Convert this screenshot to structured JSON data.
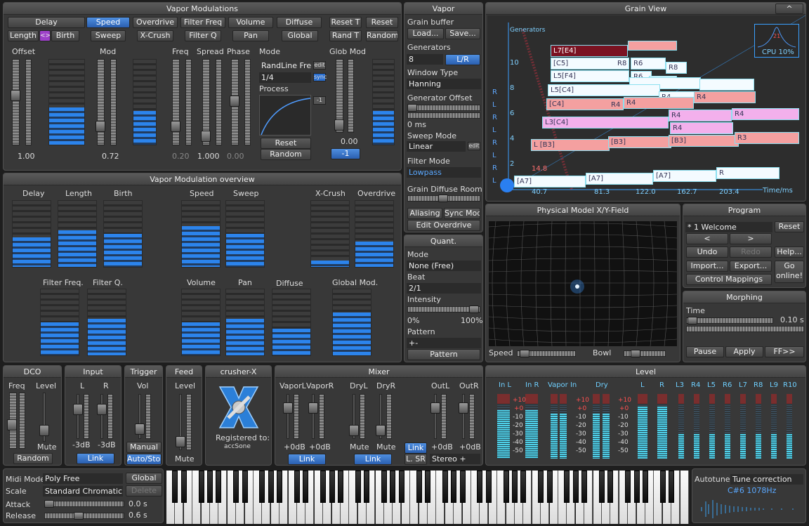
{
  "vapor_modulations": {
    "title": "Vapor Modulations",
    "buttons": [
      "Delay",
      "Speed",
      "Overdrive",
      "Filter Freq",
      "Volume",
      "Diffuse",
      "Reset T",
      "Reset",
      "Length",
      "<>",
      "Birth",
      "Sweep",
      "X-Crush",
      "Filter Q",
      "Pan",
      "Global",
      "Rand T",
      "Random"
    ],
    "labels": [
      "Offset",
      "Mod",
      "Freq",
      "Spread",
      "Phase",
      "Mode",
      "Glob Mod",
      "Process"
    ],
    "values": {
      "offset": "1.00",
      "mod": "0.72",
      "freq": "0.20",
      "spread": "1.000",
      "phase": "0.00",
      "glob": "0.00",
      "mode_badge": "-1"
    },
    "mode": "RandLine Free",
    "rate": "1/4",
    "sync": "sync",
    "edit": "edit",
    "process_badge": "-1",
    "reset": "Reset",
    "random": "Random"
  },
  "overview": {
    "title": "Vapor Modulation overview",
    "labels": [
      "Delay",
      "Length",
      "Birth",
      "Speed",
      "Sweep",
      "X-Crush",
      "Overdrive",
      "Filter Freq.",
      "Filter Q.",
      "Volume",
      "Pan",
      "Diffuse",
      "Global Mod."
    ],
    "levels": [
      0.45,
      0.55,
      0.5,
      0.62,
      0.5,
      0.1,
      0.38,
      0.5,
      0.55,
      0.5,
      0.55,
      0.4,
      0.65
    ]
  },
  "vapor": {
    "title": "Vapor",
    "grain_buffer": "Grain buffer",
    "load": "Load...",
    "save": "Save...",
    "generators_label": "Generators",
    "generators": "8",
    "lr": "L/R",
    "window_type_label": "Window Type",
    "window_type": "Hanning",
    "gen_offset_label": "Generator Offset",
    "gen_offset": "0 ms",
    "sweep_mode_label": "Sweep Mode",
    "sweep_mode": "Linear",
    "edit": "edit",
    "filter_mode_label": "Filter Mode",
    "filter_mode": "Lowpass",
    "diffuse_label": "Grain Diffuse Room",
    "aliasing": "Aliasing",
    "sync_mod": "Sync Mod",
    "edit_overdrive": "Edit Overdrive"
  },
  "grain_view": {
    "title": "Grain View",
    "collapse": "^",
    "y_label": "Generators",
    "x_label": "Time/ms",
    "y_ticks": [
      "10",
      "8",
      "6",
      "4",
      "2"
    ],
    "x_ticks": [
      "40.7",
      "81.3",
      "122.0",
      "162.7",
      "203.4"
    ],
    "lr": [
      "R",
      "L",
      "R",
      "L",
      "R",
      "L",
      "R",
      "L"
    ],
    "marker": "14.8",
    "cpu": "CPU 10%",
    "cpu_value": "21",
    "bar_labels": [
      "L7[E4]",
      "[C5]",
      "R8",
      "R6",
      "R8",
      "R6",
      "R8",
      "L5[F4]",
      "L5[C4]",
      "R4",
      "[C4]",
      "R4",
      "R4",
      "R4",
      "R4",
      "L3[C4]",
      "R4",
      "R4",
      "R3",
      "L [B3]",
      "[B3]",
      "R3",
      "[B3]",
      "R1",
      "[A7]",
      "R",
      "[A7]",
      "R",
      "[A7]",
      "R",
      "R",
      "R"
    ]
  },
  "xy_field": {
    "title": "Physical Model X/Y-Field",
    "speed": "Speed",
    "bowl": "Bowl"
  },
  "quant": {
    "title": "Quant.",
    "mode_label": "Mode",
    "mode": "None (Free)",
    "beat_label": "Beat",
    "beat": "2/1",
    "intensity_label": "Intensity",
    "min": "0%",
    "max": "100%",
    "pattern_label": "Pattern",
    "pattern_value": "+-",
    "pattern_button": "Pattern"
  },
  "program": {
    "title": "Program",
    "name": "* 1 Welcome",
    "reset": "Reset",
    "prev": "<",
    "next": ">",
    "undo": "Undo",
    "redo": "Redo",
    "help": "Help...",
    "import": "Import...",
    "export": "Export...",
    "go_online": "Go online!",
    "control_mappings": "Control Mappings"
  },
  "morphing": {
    "title": "Morphing",
    "time_label": "Time",
    "time": "0.10 s",
    "pause": "Pause",
    "apply": "Apply",
    "ff": "FF>>"
  },
  "dco": {
    "title": "DCO",
    "freq": "Freq",
    "level": "Level",
    "mute": "Mute",
    "random": "Random"
  },
  "input": {
    "title": "Input",
    "l": "L",
    "r": "R",
    "l_val": "-3dB",
    "r_val": "-3dB",
    "link": "Link"
  },
  "trigger": {
    "title": "Trigger",
    "vol": "Vol",
    "manual": "Manual",
    "autostop": "Auto/Stop"
  },
  "feed": {
    "title": "Feed",
    "level": "Level",
    "mute": "Mute"
  },
  "crusher": {
    "title": "crusher-X",
    "registered": "Registered to:",
    "user": "accSone"
  },
  "mixer": {
    "title": "Mixer",
    "labels": [
      "VaporL",
      "VaporR",
      "DryL",
      "DryR",
      "OutL",
      "OutR"
    ],
    "values": [
      "+0dB",
      "+0dB",
      "Mute",
      "Mute",
      "+0dB",
      "+0dB"
    ],
    "link": "Link",
    "lsr": "L. SR",
    "stereo": "Stereo +"
  },
  "level": {
    "title": "Level",
    "labels": [
      "In L",
      "In R",
      "Vapor In",
      "Dry",
      "L",
      "R",
      "L3",
      "R4",
      "L5",
      "R6",
      "L7",
      "R8",
      "L9",
      "R10"
    ],
    "scale": [
      "+10",
      "+0",
      "-10",
      "-20",
      "-30",
      "-40",
      "-50"
    ],
    "levels": [
      0.75,
      0.75,
      0.7,
      0.7,
      0.8,
      0.8,
      0.38,
      0.38,
      0.38,
      0.38,
      0.38,
      0.38,
      0.38,
      0.38
    ]
  },
  "midi": {
    "midi_mode_label": "Midi Mode",
    "midi_mode": "Poly Free",
    "global": "Global",
    "scale_label": "Scale",
    "scale": "Standard Chromatic",
    "delete": "Delete",
    "attack_label": "Attack",
    "attack": "0.0 s",
    "release_label": "Release",
    "release": "0.6 s"
  },
  "autotune": {
    "label": "Autotune",
    "mode": "Tune correction",
    "note": "C#6 1078Hz"
  }
}
